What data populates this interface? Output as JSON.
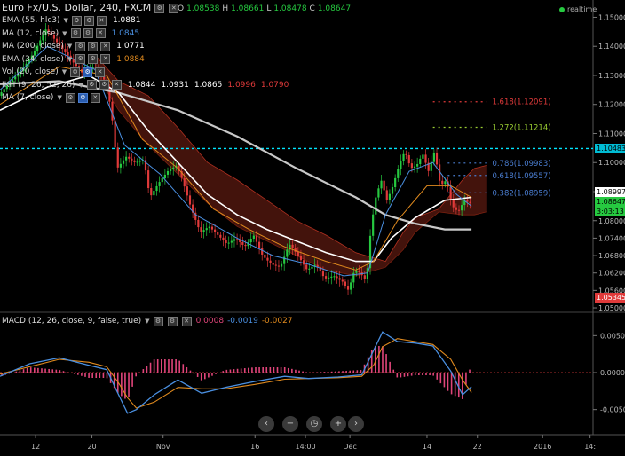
{
  "header": {
    "title": "Euro Fx/U.S. Dollar, 240, FXCM",
    "ohlc": [
      {
        "label": "O",
        "value": "1.08538"
      },
      {
        "label": "H",
        "value": "1.08661"
      },
      {
        "label": "L",
        "value": "1.08478"
      },
      {
        "label": "C",
        "value": "1.08647"
      }
    ],
    "status": "realtime"
  },
  "indicators": [
    {
      "name": "EMA (55, hlc3)",
      "values": [
        {
          "text": "1.0881",
          "color": "#ffffff"
        }
      ]
    },
    {
      "name": "MA (12, close)",
      "values": [
        {
          "text": "1.0845",
          "color": "#4a8fe0"
        }
      ]
    },
    {
      "name": "MA (200, close)",
      "values": [
        {
          "text": "1.0771",
          "color": "#ffffff"
        }
      ]
    },
    {
      "name": "EMA (34, close)",
      "values": [
        {
          "text": "1.0884",
          "color": "#e08a1e"
        }
      ]
    },
    {
      "name": "Vol (20, close)",
      "values": []
    },
    {
      "name": "IKH (9, 26, 52, 26)",
      "values": [
        {
          "text": "1.0844",
          "color": "#ffffff"
        },
        {
          "text": "1.0931",
          "color": "#ffffff"
        },
        {
          "text": "1.0865",
          "color": "#ffffff"
        },
        {
          "text": "1.0996",
          "color": "#e03a3a"
        },
        {
          "text": "1.0790",
          "color": "#e03a3a"
        }
      ]
    },
    {
      "name": "MA (7, close)",
      "values": []
    }
  ],
  "macd": {
    "name": "MACD (12, 26, close, 9, false, true)",
    "values": [
      {
        "text": "0.0008",
        "color": "#e0457a"
      },
      {
        "text": "-0.0019",
        "color": "#4a8fe0"
      },
      {
        "text": "-0.0027",
        "color": "#e08a1e"
      }
    ]
  },
  "nav_buttons": [
    "‹",
    "−",
    "◷",
    "+",
    "›"
  ],
  "colors": {
    "candle_up": "#26c940",
    "candle_down": "#e03a3a",
    "fib_1618": "#e03a3a",
    "fib_1272": "#9acd32",
    "fib_retrace": "#4a7dd0",
    "resistance": "#00e5ff",
    "cloud": "#5a1a10"
  },
  "chart_data": {
    "type": "candlestick",
    "ylim": [
      1.0497,
      1.1535
    ],
    "y_ticks": [
      "1.15000",
      "1.14000",
      "1.13000",
      "1.12000",
      "1.11000",
      "1.10000",
      "1.09000",
      "1.08000",
      "1.07400",
      "1.06800",
      "1.06200",
      "1.05600",
      "1.05000"
    ],
    "x_ticks": [
      {
        "label": "12",
        "pos": 0.06
      },
      {
        "label": "20",
        "pos": 0.155
      },
      {
        "label": "Nov",
        "pos": 0.275
      },
      {
        "label": "16",
        "pos": 0.43
      },
      {
        "label": "14:00",
        "pos": 0.515
      },
      {
        "label": "Dec",
        "pos": 0.59
      },
      {
        "label": "14",
        "pos": 0.72
      },
      {
        "label": "22",
        "pos": 0.805
      },
      {
        "label": "2016",
        "pos": 0.915
      },
      {
        "label": "14:",
        "pos": 0.995
      }
    ],
    "close_path": [
      [
        0.0,
        1.123
      ],
      [
        0.02,
        1.128
      ],
      [
        0.04,
        1.132
      ],
      [
        0.06,
        1.138
      ],
      [
        0.08,
        1.146
      ],
      [
        0.1,
        1.141
      ],
      [
        0.12,
        1.136
      ],
      [
        0.14,
        1.131
      ],
      [
        0.16,
        1.133
      ],
      [
        0.18,
        1.128
      ],
      [
        0.19,
        1.118
      ],
      [
        0.2,
        1.098
      ],
      [
        0.215,
        1.102
      ],
      [
        0.23,
        1.1
      ],
      [
        0.245,
        1.101
      ],
      [
        0.255,
        1.088
      ],
      [
        0.27,
        1.093
      ],
      [
        0.285,
        1.097
      ],
      [
        0.3,
        1.099
      ],
      [
        0.31,
        1.094
      ],
      [
        0.325,
        1.084
      ],
      [
        0.34,
        1.076
      ],
      [
        0.355,
        1.078
      ],
      [
        0.37,
        1.075
      ],
      [
        0.385,
        1.072
      ],
      [
        0.4,
        1.074
      ],
      [
        0.415,
        1.071
      ],
      [
        0.43,
        1.075
      ],
      [
        0.445,
        1.068
      ],
      [
        0.46,
        1.065
      ],
      [
        0.475,
        1.064
      ],
      [
        0.49,
        1.072
      ],
      [
        0.505,
        1.068
      ],
      [
        0.52,
        1.063
      ],
      [
        0.535,
        1.065
      ],
      [
        0.55,
        1.06
      ],
      [
        0.565,
        1.061
      ],
      [
        0.58,
        1.059
      ],
      [
        0.59,
        1.056
      ],
      [
        0.6,
        1.063
      ],
      [
        0.61,
        1.062
      ],
      [
        0.62,
        1.059
      ],
      [
        0.628,
        1.078
      ],
      [
        0.636,
        1.088
      ],
      [
        0.645,
        1.094
      ],
      [
        0.655,
        1.087
      ],
      [
        0.665,
        1.092
      ],
      [
        0.675,
        1.099
      ],
      [
        0.685,
        1.104
      ],
      [
        0.695,
        1.098
      ],
      [
        0.705,
        1.099
      ],
      [
        0.715,
        1.103
      ],
      [
        0.725,
        1.097
      ],
      [
        0.735,
        1.104
      ],
      [
        0.745,
        1.092
      ],
      [
        0.755,
        1.094
      ],
      [
        0.765,
        1.085
      ],
      [
        0.775,
        1.083
      ],
      [
        0.785,
        1.087
      ],
      [
        0.795,
        1.086
      ]
    ],
    "overlays": [
      {
        "name": "MA (200, close)",
        "color": "#c8c8c8",
        "width": 2.2,
        "points": [
          [
            0.0,
            1.127
          ],
          [
            0.1,
            1.128
          ],
          [
            0.2,
            1.124
          ],
          [
            0.3,
            1.118
          ],
          [
            0.4,
            1.109
          ],
          [
            0.5,
            1.098
          ],
          [
            0.6,
            1.088
          ],
          [
            0.65,
            1.082
          ],
          [
            0.7,
            1.079
          ],
          [
            0.75,
            1.077
          ],
          [
            0.795,
            1.077
          ]
        ]
      },
      {
        "name": "EMA (55, hlc3)",
        "color": "#ffffff",
        "width": 1.6,
        "points": [
          [
            0.0,
            1.118
          ],
          [
            0.08,
            1.126
          ],
          [
            0.15,
            1.13
          ],
          [
            0.2,
            1.124
          ],
          [
            0.25,
            1.111
          ],
          [
            0.3,
            1.1
          ],
          [
            0.35,
            1.089
          ],
          [
            0.4,
            1.082
          ],
          [
            0.45,
            1.077
          ],
          [
            0.5,
            1.073
          ],
          [
            0.55,
            1.069
          ],
          [
            0.6,
            1.066
          ],
          [
            0.63,
            1.066
          ],
          [
            0.66,
            1.074
          ],
          [
            0.7,
            1.081
          ],
          [
            0.75,
            1.087
          ],
          [
            0.795,
            1.088
          ]
        ]
      },
      {
        "name": "EMA (34, close)",
        "color": "#e08a1e",
        "width": 1.0,
        "points": [
          [
            0.0,
            1.12
          ],
          [
            0.1,
            1.133
          ],
          [
            0.18,
            1.13
          ],
          [
            0.24,
            1.108
          ],
          [
            0.3,
            1.098
          ],
          [
            0.36,
            1.084
          ],
          [
            0.42,
            1.077
          ],
          [
            0.48,
            1.071
          ],
          [
            0.55,
            1.066
          ],
          [
            0.6,
            1.063
          ],
          [
            0.63,
            1.066
          ],
          [
            0.67,
            1.08
          ],
          [
            0.72,
            1.092
          ],
          [
            0.76,
            1.092
          ],
          [
            0.795,
            1.088
          ]
        ]
      },
      {
        "name": "MA (12, close)",
        "color": "#4a8fe0",
        "width": 1.0,
        "points": [
          [
            0.0,
            1.125
          ],
          [
            0.08,
            1.14
          ],
          [
            0.16,
            1.132
          ],
          [
            0.21,
            1.106
          ],
          [
            0.27,
            1.096
          ],
          [
            0.33,
            1.082
          ],
          [
            0.4,
            1.074
          ],
          [
            0.46,
            1.068
          ],
          [
            0.52,
            1.065
          ],
          [
            0.58,
            1.061
          ],
          [
            0.62,
            1.062
          ],
          [
            0.65,
            1.082
          ],
          [
            0.69,
            1.097
          ],
          [
            0.73,
            1.1
          ],
          [
            0.77,
            1.089
          ],
          [
            0.795,
            1.085
          ]
        ]
      }
    ],
    "cloud": {
      "top": [
        [
          0.16,
          1.137
        ],
        [
          0.2,
          1.128
        ],
        [
          0.25,
          1.123
        ],
        [
          0.3,
          1.112
        ],
        [
          0.35,
          1.1
        ],
        [
          0.4,
          1.094
        ],
        [
          0.45,
          1.087
        ],
        [
          0.5,
          1.08
        ],
        [
          0.55,
          1.075
        ],
        [
          0.6,
          1.069
        ],
        [
          0.65,
          1.066
        ],
        [
          0.68,
          1.076
        ],
        [
          0.7,
          1.081
        ],
        [
          0.74,
          1.084
        ],
        [
          0.78,
          1.094
        ],
        [
          0.8,
          1.098
        ],
        [
          0.82,
          1.099
        ]
      ],
      "bottom": [
        [
          0.16,
          1.131
        ],
        [
          0.2,
          1.118
        ],
        [
          0.25,
          1.106
        ],
        [
          0.3,
          1.096
        ],
        [
          0.35,
          1.086
        ],
        [
          0.4,
          1.078
        ],
        [
          0.45,
          1.073
        ],
        [
          0.5,
          1.068
        ],
        [
          0.55,
          1.063
        ],
        [
          0.6,
          1.061
        ],
        [
          0.65,
          1.064
        ],
        [
          0.68,
          1.07
        ],
        [
          0.7,
          1.076
        ],
        [
          0.74,
          1.083
        ],
        [
          0.78,
          1.082
        ],
        [
          0.8,
          1.082
        ],
        [
          0.82,
          1.083
        ]
      ]
    },
    "fib_levels": [
      {
        "label": "1.618(1.12091)",
        "value": 1.12091,
        "color": "#e03a3a"
      },
      {
        "label": "1.272(1.11214)",
        "value": 1.11214,
        "color": "#9acd32"
      },
      {
        "label": "0.786(1.09983)",
        "value": 1.09983,
        "color": "#4a7dd0"
      },
      {
        "label": "0.618(1.09557)",
        "value": 1.09557,
        "color": "#4a7dd0"
      },
      {
        "label": "0.382(1.08959)",
        "value": 1.08959,
        "color": "#4a7dd0"
      }
    ],
    "resistance_line": 1.10483,
    "price_labels": [
      {
        "text": "1.10483",
        "value": 1.10483,
        "bg": "#00bcd4",
        "fg": "#000000"
      },
      {
        "text": "1.08997",
        "value": 1.08997,
        "bg": "#ffffff",
        "fg": "#000000"
      },
      {
        "text": "1.08647",
        "value": 1.08647,
        "bg": "#26c940",
        "fg": "#000000"
      },
      {
        "text": "3:03:13",
        "value": 1.0832,
        "bg": "#26c940",
        "fg": "#000000"
      },
      {
        "text": "1.05345",
        "value": 1.05345,
        "bg": "#e03a3a",
        "fg": "#ffffff"
      }
    ],
    "macd_ylim": [
      -0.0072,
      0.0072
    ],
    "macd_ticks": [
      "0.0050",
      "0.0000",
      "-0.0050"
    ],
    "macd_line": [
      [
        0.0,
        -0.0005
      ],
      [
        0.05,
        0.0012
      ],
      [
        0.1,
        0.002
      ],
      [
        0.15,
        0.001
      ],
      [
        0.18,
        0.0004
      ],
      [
        0.2,
        -0.003
      ],
      [
        0.215,
        -0.0055
      ],
      [
        0.23,
        -0.005
      ],
      [
        0.26,
        -0.003
      ],
      [
        0.3,
        -0.001
      ],
      [
        0.34,
        -0.0028
      ],
      [
        0.38,
        -0.002
      ],
      [
        0.43,
        -0.0012
      ],
      [
        0.48,
        -0.0005
      ],
      [
        0.52,
        -0.0008
      ],
      [
        0.57,
        -0.0006
      ],
      [
        0.61,
        -0.0003
      ],
      [
        0.63,
        0.003
      ],
      [
        0.645,
        0.0055
      ],
      [
        0.67,
        0.0042
      ],
      [
        0.7,
        0.004
      ],
      [
        0.73,
        0.0036
      ],
      [
        0.76,
        0.0002
      ],
      [
        0.78,
        -0.003
      ],
      [
        0.795,
        -0.0019
      ]
    ],
    "signal_line": [
      [
        0.0,
        -0.0002
      ],
      [
        0.05,
        0.0008
      ],
      [
        0.1,
        0.0018
      ],
      [
        0.15,
        0.0014
      ],
      [
        0.18,
        0.0008
      ],
      [
        0.2,
        -0.0014
      ],
      [
        0.215,
        -0.0034
      ],
      [
        0.23,
        -0.0048
      ],
      [
        0.26,
        -0.004
      ],
      [
        0.3,
        -0.002
      ],
      [
        0.34,
        -0.0022
      ],
      [
        0.38,
        -0.0022
      ],
      [
        0.43,
        -0.0016
      ],
      [
        0.48,
        -0.0009
      ],
      [
        0.52,
        -0.0008
      ],
      [
        0.57,
        -0.0007
      ],
      [
        0.61,
        -0.0005
      ],
      [
        0.63,
        0.001
      ],
      [
        0.645,
        0.0035
      ],
      [
        0.67,
        0.0046
      ],
      [
        0.7,
        0.0042
      ],
      [
        0.73,
        0.0038
      ],
      [
        0.76,
        0.0018
      ],
      [
        0.78,
        -0.001
      ],
      [
        0.795,
        -0.0027
      ]
    ]
  }
}
